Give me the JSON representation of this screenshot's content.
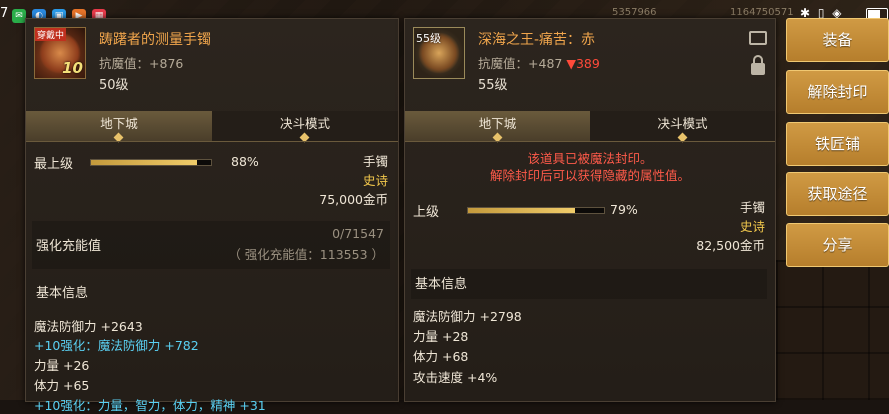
{
  "status_bar": {
    "time": "7",
    "apps": [
      "WeChat",
      "Edge",
      "Bili",
      "Pay",
      "Red"
    ],
    "center_num_1": "5357966",
    "center_num_2": "1164750571",
    "network": "✱ ▯ ◈",
    "battery": "battery"
  },
  "left_item": {
    "name": "踌躇者的测量手镯",
    "resist_label": "抗魔值：",
    "resist_value": "+876",
    "level": "50级",
    "icon": "bracelet-icon",
    "icon_badge_level": "10",
    "icon_badge_corner": "穿戴中",
    "tabs": [
      "地下城",
      "决斗模式"
    ],
    "upgrade_label": "最上级",
    "progress_percent": 88,
    "progress_text": "88%",
    "type": "手镯",
    "rarity": "史诗",
    "price": "75,000金币",
    "enhance_title": "强化充能值",
    "enhance_value_1": "0/71547",
    "enhance_value_2": "（ 强化充能值：113553 ）",
    "basic_info_title": "基本信息",
    "stats": [
      {
        "text": "魔法防御力 +2643",
        "color": "normal"
      },
      {
        "text": "+10强化：魔法防御力 +782",
        "color": "cyan"
      },
      {
        "text": "力量 +26",
        "color": "normal"
      },
      {
        "text": "体力 +65",
        "color": "normal"
      }
    ],
    "cut_line": "+10强化：力量，智力，体力，精神 +31"
  },
  "right_item": {
    "name": "深海之王-痛苦：赤",
    "resist_label": "抗魔值：",
    "resist_value": "+487",
    "resist_drop": "▼389",
    "level": "55级",
    "icon_badge_level": "55级",
    "tabs": [
      "地下城",
      "决斗模式"
    ],
    "warning_1": "该道具已被魔法封印。",
    "warning_2": "解除封印后可以获得隐藏的属性值。",
    "upgrade_label": "上级",
    "progress_percent": 79,
    "progress_text": "79%",
    "type": "手镯",
    "rarity": "史诗",
    "price": "82,500金币",
    "basic_info_title": "基本信息",
    "stats": [
      "魔法防御力 +2798",
      "力量 +28",
      "体力 +68",
      "攻击速度 +4%"
    ]
  },
  "actions": [
    "装备",
    "解除封印",
    "铁匠铺",
    "获取途径",
    "分享"
  ],
  "colors": {
    "accent_gold": "#f0cc6a",
    "epic": "#f2c84c",
    "warning": "#ff5a4a",
    "enhance_cyan": "#5ad0f2",
    "button": "#c48a36"
  }
}
